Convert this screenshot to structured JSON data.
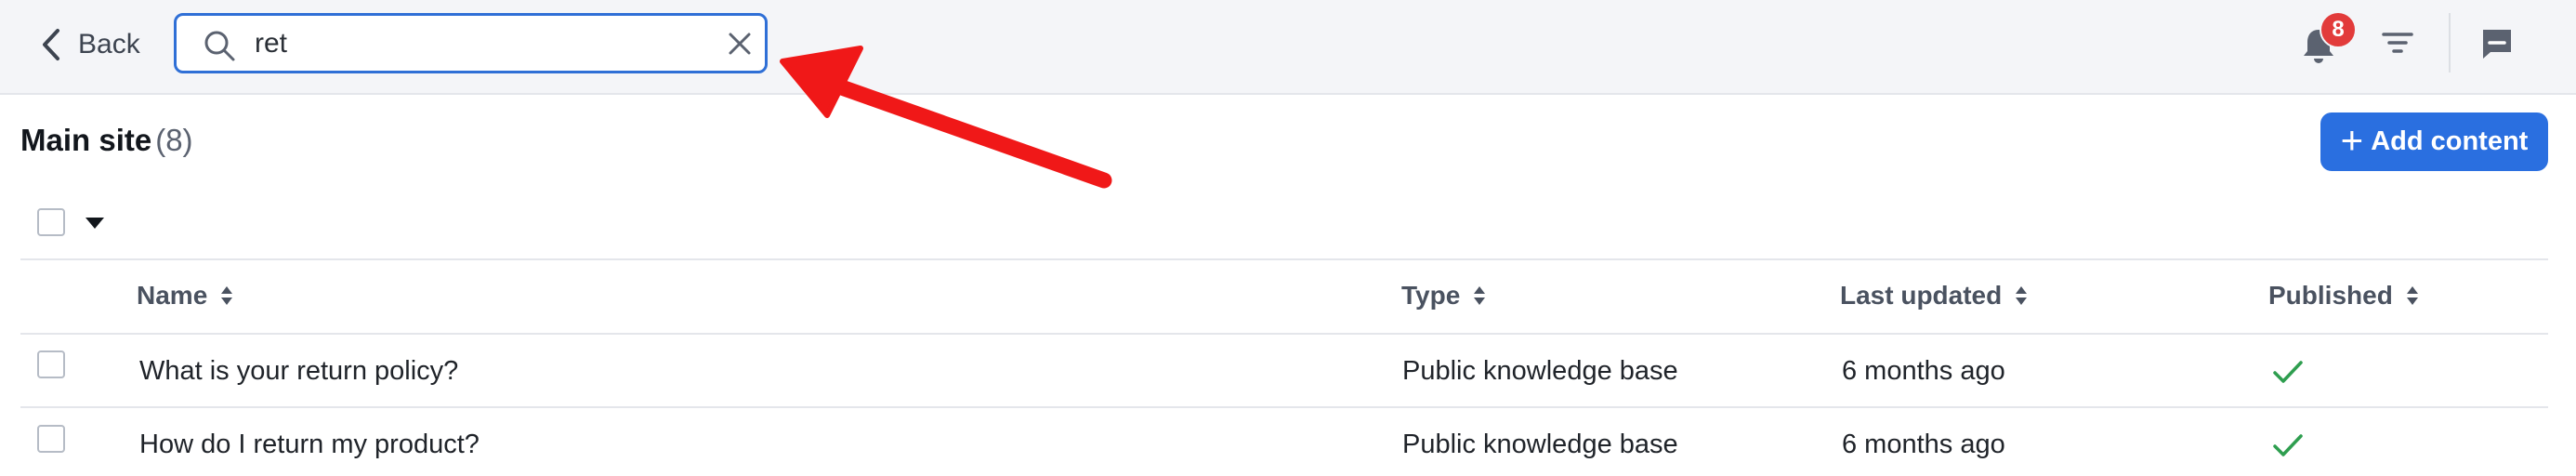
{
  "header": {
    "back_label": "Back",
    "search": {
      "value": "ret",
      "placeholder": ""
    },
    "notifications_count": "8"
  },
  "main": {
    "title": "Main site",
    "count": "(8)",
    "add_button": {
      "plus": "+",
      "label": "Add content"
    }
  },
  "table": {
    "columns": [
      "Name",
      "Type",
      "Last updated",
      "Published"
    ],
    "rows": [
      {
        "name": "What is your return policy?",
        "type": "Public knowledge base",
        "last_updated": "6 months ago",
        "published": true
      },
      {
        "name": "How do I return my product?",
        "type": "Public knowledge base",
        "last_updated": "6 months ago",
        "published": true
      }
    ]
  },
  "colors": {
    "accent": "#2a6fe0",
    "badge": "#e23b3b",
    "published_check": "#2e9e4f",
    "annotation_arrow": "#f01818"
  },
  "icons": [
    "chevron-left-icon",
    "search-icon",
    "close-icon",
    "bell-icon",
    "filter-icon",
    "chat-icon",
    "caret-down-icon",
    "sort-icon",
    "check-icon"
  ]
}
